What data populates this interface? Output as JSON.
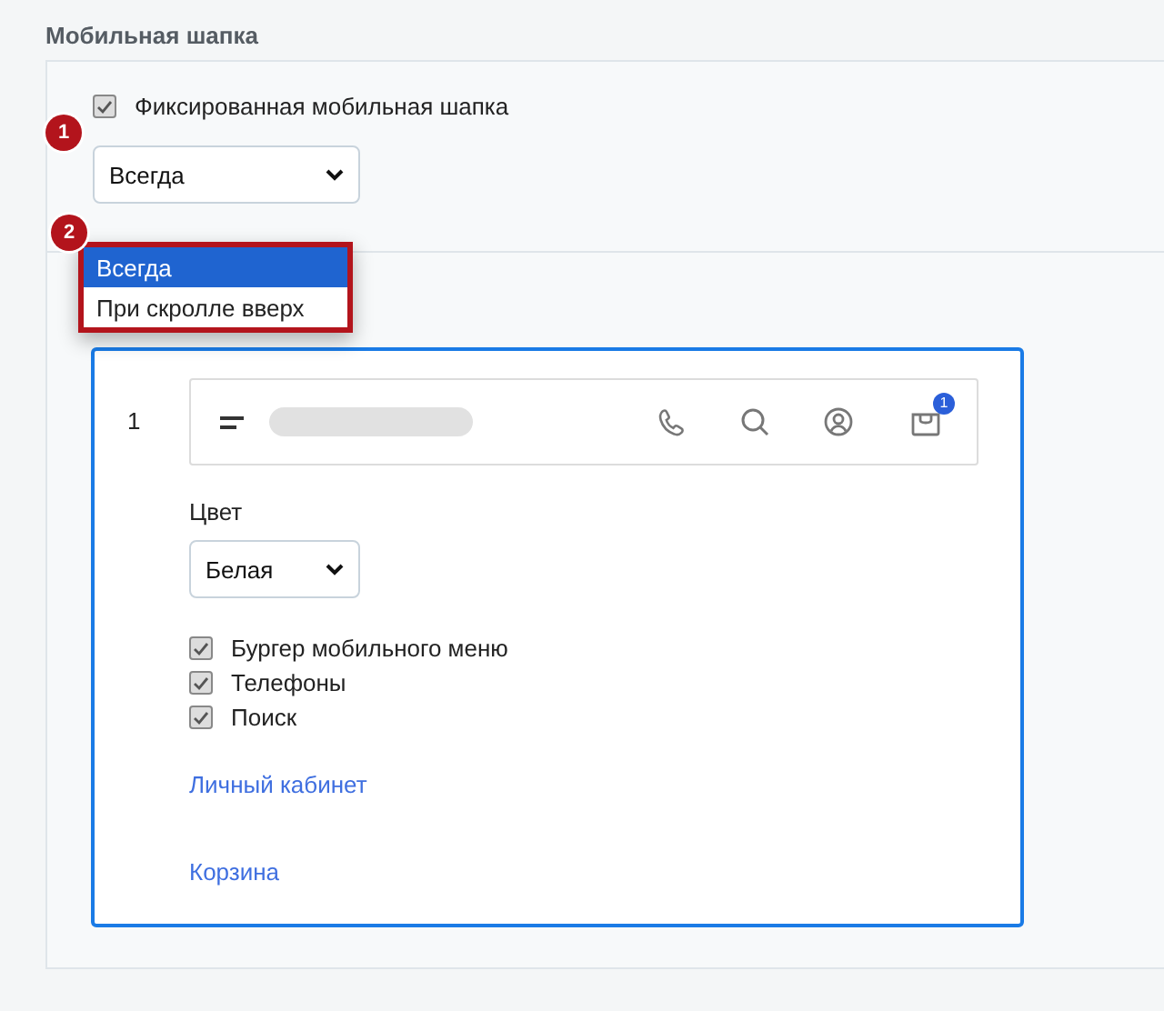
{
  "section_title": "Мобильная шапка",
  "fixed_header": {
    "marker": "1",
    "label": "Фиксированная мобильная шапка",
    "checked": true
  },
  "mode_select": {
    "value": "Всегда"
  },
  "dropdown": {
    "marker": "2",
    "options": [
      {
        "label": "Всегда",
        "selected": true
      },
      {
        "label": "При скролле вверх",
        "selected": false
      }
    ]
  },
  "preview": {
    "row_number": "1",
    "cart_badge": "1"
  },
  "color_field": {
    "label": "Цвет",
    "value": "Белая"
  },
  "options": [
    {
      "label": "Бургер мобильного меню",
      "checked": true
    },
    {
      "label": "Телефоны",
      "checked": true
    },
    {
      "label": "Поиск",
      "checked": true
    }
  ],
  "links": [
    "Личный кабинет",
    "Корзина"
  ]
}
